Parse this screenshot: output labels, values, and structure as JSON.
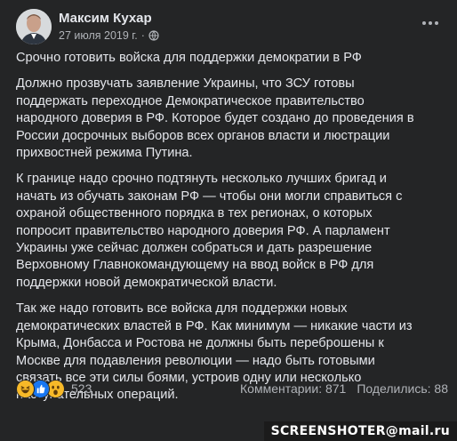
{
  "post": {
    "author": "Максим Кухар",
    "date": "27 июля 2019 г.",
    "separator": "·",
    "title": "Срочно готовить войска для поддержки демократии в РФ",
    "paragraphs": [
      [
        "Должно прозвучать заявление Украины, что ЗСУ готовы",
        "поддержать переходное Демократическое правительство",
        "народного доверия в РФ. Которое будет создано до проведения в",
        "России досрочных выборов всех органов власти и люстрации",
        "прихвостней режима Путина."
      ],
      [
        "К границе надо срочно подтянуть несколько лучших бригад и",
        "начать из обучать законам РФ — чтобы они могли справиться с",
        "охраной общественного порядка в тех регионах, о которых",
        "попросит правительство народного доверия РФ. А парламент",
        "Украины уже сейчас должен собраться и дать разрешение",
        "Верховному Главнокомандующему на ввод войск в РФ для",
        "поддержки новой демократической власти."
      ],
      [
        "Так же надо готовить все войска для поддержки новых",
        "демократических властей в РФ. Как минимум — никакие части из",
        "Крыма, Донбасса и Ростова не должны быть переброшены к",
        "Москве для подавления революции — надо быть готовыми",
        "связать все эти силы боями, устроив одну или несколько",
        "наступательных операций."
      ]
    ]
  },
  "footer": {
    "reaction_icons": [
      "laughing-haha-icon",
      "like-icon",
      "wow-icon"
    ],
    "reaction_count": "523",
    "comments_label": "Комментарии: 871",
    "shares_label": "Поделились: 88"
  },
  "watermark": "SCREENSHOTER@mail.ru",
  "colors": {
    "background": "#242526",
    "text": "#e4e6eb",
    "secondary_text": "#b0b3b8",
    "like_blue": "#1877f2",
    "emoji_yellow": "#f7b928"
  }
}
